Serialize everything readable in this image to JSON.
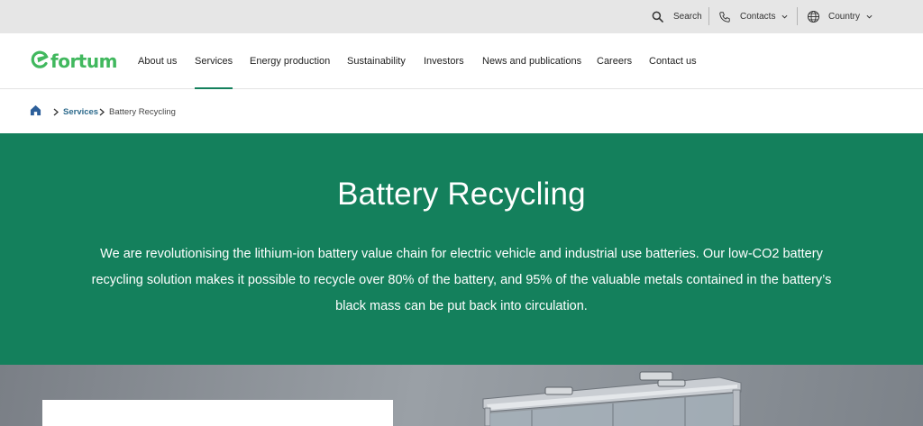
{
  "utility": {
    "search_label": "Search",
    "contacts_label": "Contacts",
    "country_label": "Country"
  },
  "brand": {
    "logo_text": "fortum",
    "brand_color": "#41b85e",
    "accent_color": "#14805c"
  },
  "nav": {
    "items": [
      {
        "label": "About us"
      },
      {
        "label": "Services"
      },
      {
        "label": "Energy production"
      },
      {
        "label": "Sustainability"
      },
      {
        "label": "Investors"
      },
      {
        "label": "News and publications"
      },
      {
        "label": "Careers"
      },
      {
        "label": "Contact us"
      }
    ],
    "active": "Services"
  },
  "breadcrumb": {
    "home_icon": "home-icon",
    "items": [
      {
        "label": "Services"
      },
      {
        "label": "Battery Recycling"
      }
    ]
  },
  "hero": {
    "title": "Battery Recycling",
    "description": "We are revolutionising the lithium-ion battery value chain for electric vehicle and industrial use batteries. Our low-CO2 battery recycling solution makes it possible to recycle over 80% of the battery, and 95% of the valuable metals contained in the battery’s black mass can be put back into circulation."
  }
}
